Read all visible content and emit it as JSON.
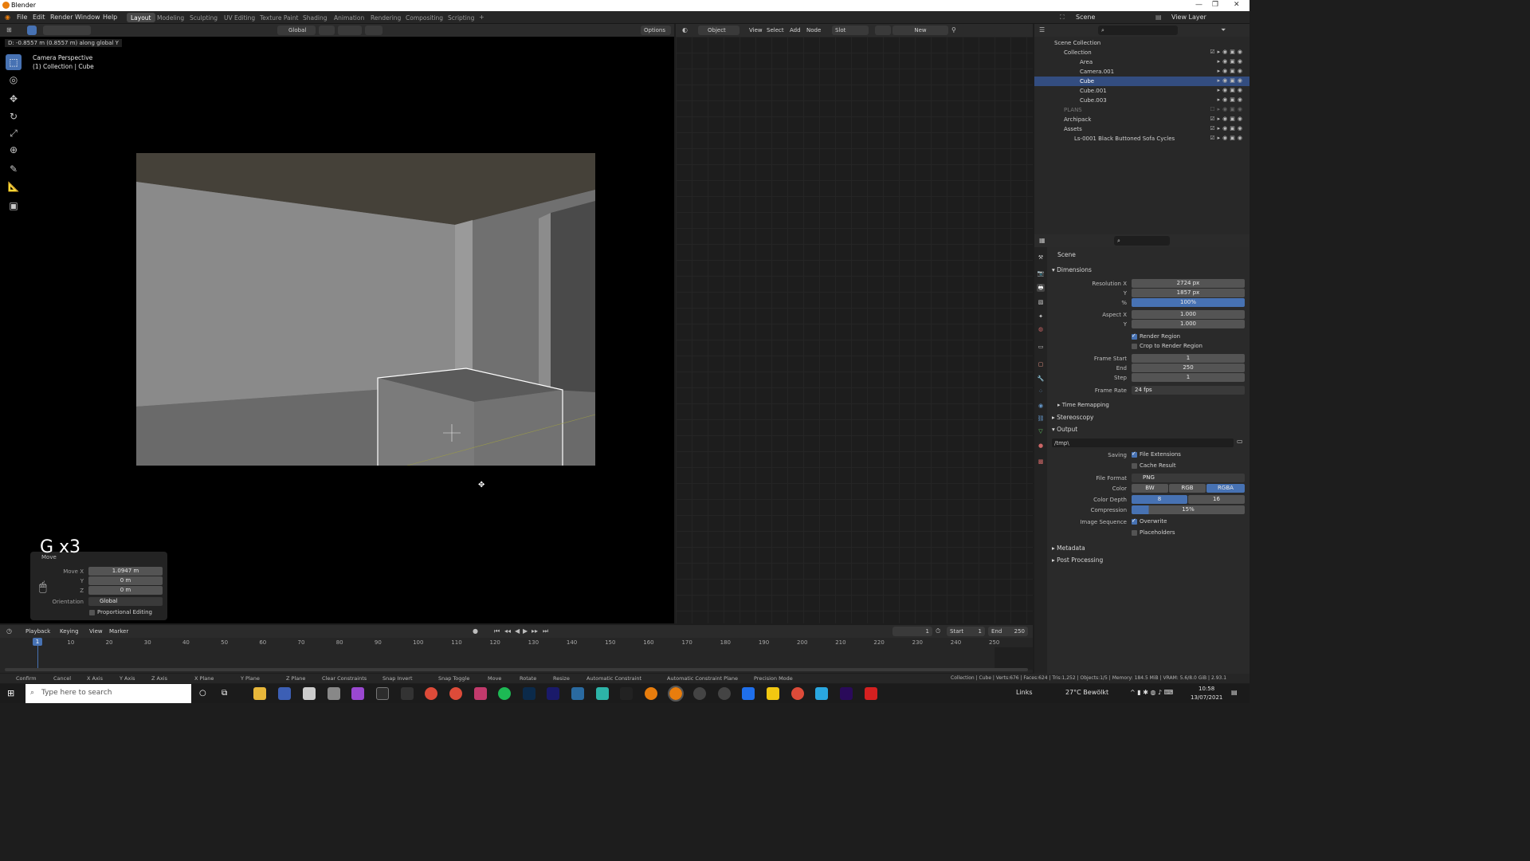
{
  "window": {
    "title": "Blender"
  },
  "menubar": {
    "items": [
      "File",
      "Edit",
      "Render",
      "Window",
      "Help"
    ],
    "workspaces": [
      "Layout",
      "Modeling",
      "Sculpting",
      "UV Editing",
      "Texture Paint",
      "Shading",
      "Animation",
      "Rendering",
      "Compositing",
      "Scripting"
    ],
    "scene": "Scene",
    "view_layer": "View Layer"
  },
  "viewport_header": {
    "orientation": "Global",
    "options": "Options"
  },
  "node_header": {
    "mode": "Object",
    "view": "View",
    "select": "Select",
    "add": "Add",
    "node": "Node",
    "slot": "Slot",
    "new": "New"
  },
  "viewport": {
    "status": "D: -0.8557 m (0.8557 m) along global Y",
    "camera": "Camera Perspective",
    "collection": "(1) Collection | Cube"
  },
  "operator": {
    "shortcut": "G x3",
    "title": "Move",
    "move_x_label": "Move X",
    "move_x": "1.0947 m",
    "y_label": "Y",
    "y": "0 m",
    "z_label": "Z",
    "z": "0 m",
    "orientation_label": "Orientation",
    "orientation": "Global",
    "proportional": "Proportional Editing"
  },
  "outliner": {
    "rows": [
      {
        "label": "Scene Collection"
      },
      {
        "label": "Collection"
      },
      {
        "label": "Area"
      },
      {
        "label": "Camera.001"
      },
      {
        "label": "Cube"
      },
      {
        "label": "Cube.001"
      },
      {
        "label": "Cube.003"
      },
      {
        "label": "PLANS"
      },
      {
        "label": "Archipack"
      },
      {
        "label": "Assets"
      },
      {
        "label": "Ls-0001 Black Buttoned Sofa Cycles"
      }
    ]
  },
  "properties": {
    "context": "Scene",
    "dimensions": "Dimensions",
    "resolution_x_label": "Resolution X",
    "resolution_x": "2724 px",
    "y_label": "Y",
    "resolution_y": "1857 px",
    "pct_label": "%",
    "resolution_pct": "100%",
    "aspect_x_label": "Aspect X",
    "aspect_x": "1.000",
    "aspect_y": "1.000",
    "render_region": "Render Region",
    "crop": "Crop to Render Region",
    "frame_start_label": "Frame Start",
    "frame_start": "1",
    "end_label": "End",
    "frame_end": "250",
    "step_label": "Step",
    "step": "1",
    "frame_rate_label": "Frame Rate",
    "frame_rate": "24 fps",
    "time_remapping": "Time Remapping",
    "stereoscopy": "Stereoscopy",
    "output": "Output",
    "path": "/tmp\\",
    "saving_label": "Saving",
    "file_ext": "File Extensions",
    "cache": "Cache Result",
    "file_format_label": "File Format",
    "file_format": "PNG",
    "color_label": "Color",
    "color_bw": "BW",
    "color_rgb": "RGB",
    "color_rgba": "RGBA",
    "depth_label": "Color Depth",
    "depth_8": "8",
    "depth_16": "16",
    "compression_label": "Compression",
    "compression": "15%",
    "image_seq_label": "Image Sequence",
    "overwrite": "Overwrite",
    "placeholders": "Placeholders",
    "metadata": "Metadata",
    "post_processing": "Post Processing"
  },
  "timeline": {
    "playback": "Playback",
    "keying": "Keying",
    "view": "View",
    "marker": "Marker",
    "current_frame": "1",
    "start_label": "Start",
    "start": "1",
    "end_label": "End",
    "end": "250",
    "ticks": [
      "1",
      "10",
      "20",
      "30",
      "40",
      "50",
      "60",
      "70",
      "80",
      "90",
      "100",
      "110",
      "120",
      "130",
      "140",
      "150",
      "160",
      "170",
      "180",
      "190",
      "200",
      "210",
      "220",
      "230",
      "240",
      "250"
    ]
  },
  "statusbar": {
    "items": [
      "Confirm",
      "Cancel",
      "X Axis",
      "Y Axis",
      "Z Axis",
      "X Plane",
      "Y Plane",
      "Z Plane",
      "Clear Constraints",
      "Snap Invert",
      "Snap Toggle",
      "Move",
      "Rotate",
      "Resize",
      "Automatic Constraint",
      "Automatic Constraint Plane",
      "Precision Mode"
    ],
    "stats": "Collection | Cube | Verts:676 | Faces:624 | Tris:1,252 | Objects:1/5 | Memory: 184.5 MiB | VRAM: 5.6/8.0 GiB | 2.93.1"
  },
  "taskbar": {
    "search_placeholder": "Type here to search",
    "links": "Links",
    "weather": "27°C  Bewölkt",
    "time": "10:58",
    "date": "13/07/2021"
  },
  "colors": {
    "accent": "#4772b3",
    "selection": "#334d80"
  }
}
